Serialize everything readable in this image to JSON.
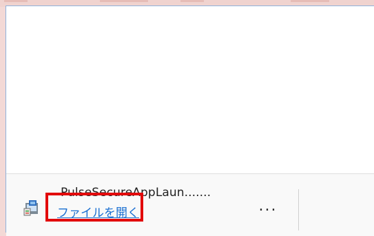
{
  "download": {
    "file_name": "PulseSecureAppLaun.......",
    "open_file_label": "ファイルを開く",
    "more_label": "..."
  },
  "icons": {
    "file_icon": "installer-file-icon",
    "more_icon": "more-options-icon"
  },
  "colors": {
    "link": "#1a6fd1",
    "highlight_border": "#e2090b",
    "panel_border": "#8fb2dc"
  }
}
